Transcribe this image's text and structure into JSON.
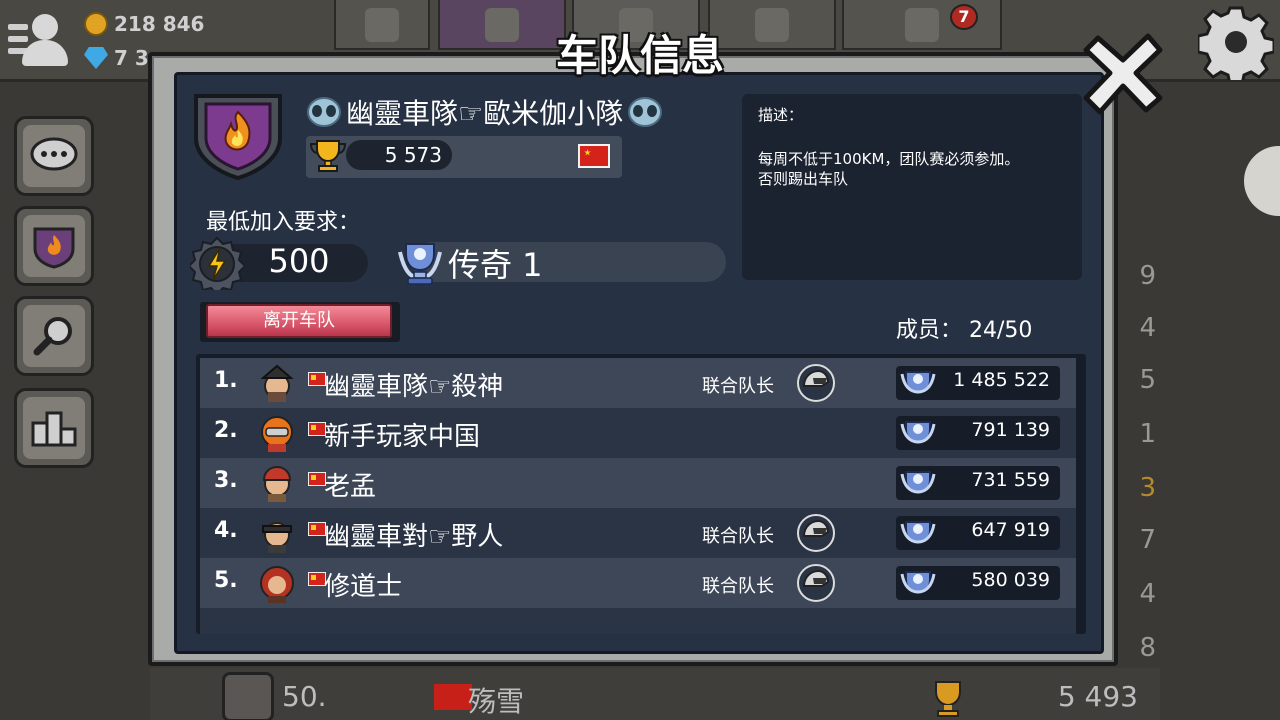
{
  "hud": {
    "coins": "218 846",
    "gems": "7 3",
    "notification_count": "7"
  },
  "dialog": {
    "title": "车队信息",
    "team": {
      "name": "幽靈車隊☞歐米伽小隊",
      "trophies": "5 573",
      "country_flag": "china-flag-icon"
    },
    "requirements": {
      "label": "最低加入要求：",
      "power": "500",
      "league": "传奇 1"
    },
    "leave_button": "离开车队",
    "members_label": "成员：  24/50",
    "description": {
      "label": "描述：",
      "text_line1": "每周不低于100KM，团队赛必须参加。",
      "text_line2": "否则踢出车队"
    }
  },
  "members": [
    {
      "rank": "1.",
      "name": "幽靈車隊☞殺神",
      "role": "联合队长",
      "score": "1 485 522"
    },
    {
      "rank": "2.",
      "name": "新手玩家中国",
      "role": "",
      "score": "791 139"
    },
    {
      "rank": "3.",
      "name": "老孟",
      "role": "",
      "score": "731 559"
    },
    {
      "rank": "4.",
      "name": "幽靈車對☞野人",
      "role": "联合队长",
      "score": "647 919"
    },
    {
      "rank": "5.",
      "name": "修道士",
      "role": "联合队长",
      "score": "580 039"
    }
  ],
  "background_row": {
    "rank": "50.",
    "name": "殇雪",
    "score": "5 493"
  },
  "background_side_numbers": [
    "9",
    "4",
    "5",
    "1",
    "3",
    "7",
    "4",
    "8"
  ],
  "colors": {
    "panel": "#263143",
    "frame": "#a9aba9",
    "leave_button": "#d9566a",
    "flag_red": "#d3231a"
  }
}
